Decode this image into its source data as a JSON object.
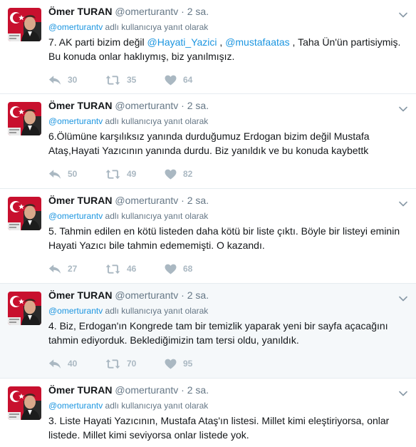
{
  "tweets": [
    {
      "name": "Ömer TURAN",
      "handle": "@omerturantv",
      "sep": "·",
      "time": "2 sa.",
      "reply_handle": "@omerturantv",
      "reply_suffix": " adlı kullanıcıya yanıt olarak",
      "text_before": "7. AK parti bizim değil ",
      "mention1": "@Hayati_Yazici",
      "text_mid": " , ",
      "mention2": "@mustafaatas",
      "text_after": " , Taha Ün'ün partisiymiş. Bu konuda onlar haklıymış, biz yanılmışız.",
      "replies": "30",
      "retweets": "35",
      "likes": "64"
    },
    {
      "name": "Ömer TURAN",
      "handle": "@omerturantv",
      "sep": "·",
      "time": "2 sa.",
      "reply_handle": "@omerturantv",
      "reply_suffix": " adlı kullanıcıya yanıt olarak",
      "text": "6.Ölümüne karşılıksız yanında durduğumuz Erdogan bizim değil Mustafa Ataş,Hayati Yazıcının yanında durdu. Biz yanıldık ve bu konuda kaybettk",
      "replies": "50",
      "retweets": "49",
      "likes": "82"
    },
    {
      "name": "Ömer TURAN",
      "handle": "@omerturantv",
      "sep": "·",
      "time": "2 sa.",
      "reply_handle": "@omerturantv",
      "reply_suffix": " adlı kullanıcıya yanıt olarak",
      "text": "5. Tahmin edilen en kötü listeden daha kötü bir liste çıktı. Böyle bir listeyi eminin Hayati Yazıcı bile tahmin edememişti. O kazandı.",
      "replies": "27",
      "retweets": "46",
      "likes": "68"
    },
    {
      "name": "Ömer TURAN",
      "handle": "@omerturantv",
      "sep": "·",
      "time": "2 sa.",
      "reply_handle": "@omerturantv",
      "reply_suffix": " adlı kullanıcıya yanıt olarak",
      "text": "4. Biz, Erdogan'ın Kongrede tam bir temizlik yaparak yeni bir sayfa açacağını tahmin ediyorduk. Beklediğimizin tam tersi oldu, yanıldık.",
      "replies": "40",
      "retweets": "70",
      "likes": "95"
    },
    {
      "name": "Ömer TURAN",
      "handle": "@omerturantv",
      "sep": "·",
      "time": "2 sa.",
      "reply_handle": "@omerturantv",
      "reply_suffix": " adlı kullanıcıya yanıt olarak",
      "text": "3. Liste Hayati Yazıcının, Mustafa Ataş'ın listesi. Millet kimi eleştiriyorsa, onlar listede. Millet kimi seviyorsa onlar listede yok."
    }
  ],
  "icons": {
    "reply": "reply-icon",
    "retweet": "retweet-icon",
    "like": "heart-icon",
    "more": "chevron-down-icon",
    "avatar": "avatar"
  },
  "colors": {
    "link": "#1b95e0",
    "muted": "#657786",
    "action": "#aab8c2",
    "highlight_bg": "#f5f8fa",
    "divider": "#e6ecf0"
  }
}
